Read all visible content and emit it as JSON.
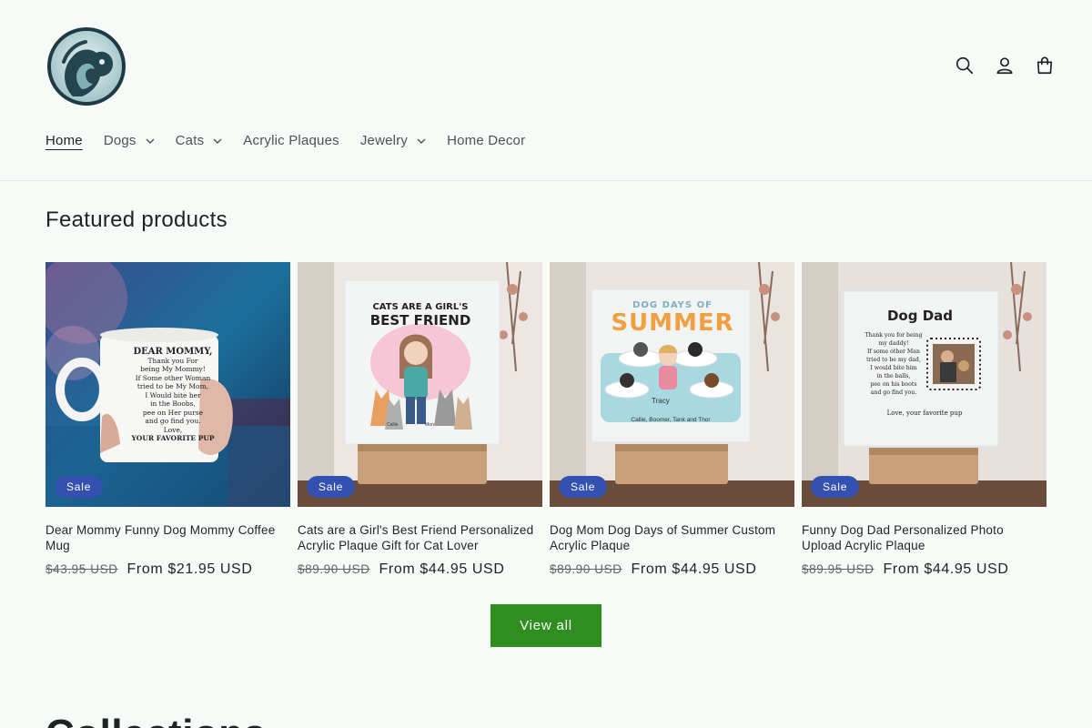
{
  "header": {
    "logo_alt": "dog-cat-logo",
    "icons": [
      "search-icon",
      "account-icon",
      "cart-icon"
    ],
    "nav": [
      {
        "label": "Home",
        "active": true,
        "dropdown": false
      },
      {
        "label": "Dogs",
        "active": false,
        "dropdown": true
      },
      {
        "label": "Cats",
        "active": false,
        "dropdown": true
      },
      {
        "label": "Acrylic Plaques",
        "active": false,
        "dropdown": false
      },
      {
        "label": "Jewelry",
        "active": false,
        "dropdown": true
      },
      {
        "label": "Home Decor",
        "active": false,
        "dropdown": false
      }
    ]
  },
  "featured": {
    "title": "Featured products",
    "products": [
      {
        "title": "Dear Mommy Funny Dog Mommy Coffee Mug",
        "old_price": "$43.95 USD",
        "price": "From $21.95 USD",
        "badge": "Sale",
        "art_text": [
          "DEAR MOMMY,",
          "Thank you For",
          "being My Mommy!",
          "If Some other Woman",
          "tried to be My Mom,",
          "I Would bite her",
          "in the Boobs,",
          "pee on Her purse",
          "and go find you.",
          "Love,",
          "YOUR FAVORITE PUP"
        ]
      },
      {
        "title": "Cats are a Girl's Best Friend Personalized Acrylic Plaque Gift for Cat Lover",
        "old_price": "$89.90 USD",
        "price": "From $44.95 USD",
        "badge": "Sale",
        "art_text": [
          "CATS ARE A GIRL'S",
          "BEST FRIEND",
          "Callie",
          "Mon"
        ]
      },
      {
        "title": "Dog Mom Dog Days of Summer Custom Acrylic Plaque",
        "old_price": "$89.90 USD",
        "price": "From $44.95 USD",
        "badge": "Sale",
        "art_text": [
          "DOG DAYS OF",
          "SUMMER",
          "Tracy",
          "Callie, Boomer, Tank and Thor"
        ]
      },
      {
        "title": "Funny Dog Dad Personalized Photo Upload Acrylic Plaque",
        "old_price": "$89.95 USD",
        "price": "From $44.95 USD",
        "badge": "Sale",
        "art_text": [
          "Dog Dad",
          "Thank you for being",
          "my daddy!",
          "If some other Man",
          "tried to be my dad,",
          "I would bite him",
          "in the balls,",
          "pee on his boots",
          "and go find you.",
          "Love, your favorite pup"
        ]
      }
    ],
    "view_all": "View all"
  },
  "collections": {
    "title": "Collections"
  },
  "colors": {
    "sale_badge": "#3450b0",
    "button": "#2e8f1f",
    "background": "#f8faf8"
  }
}
